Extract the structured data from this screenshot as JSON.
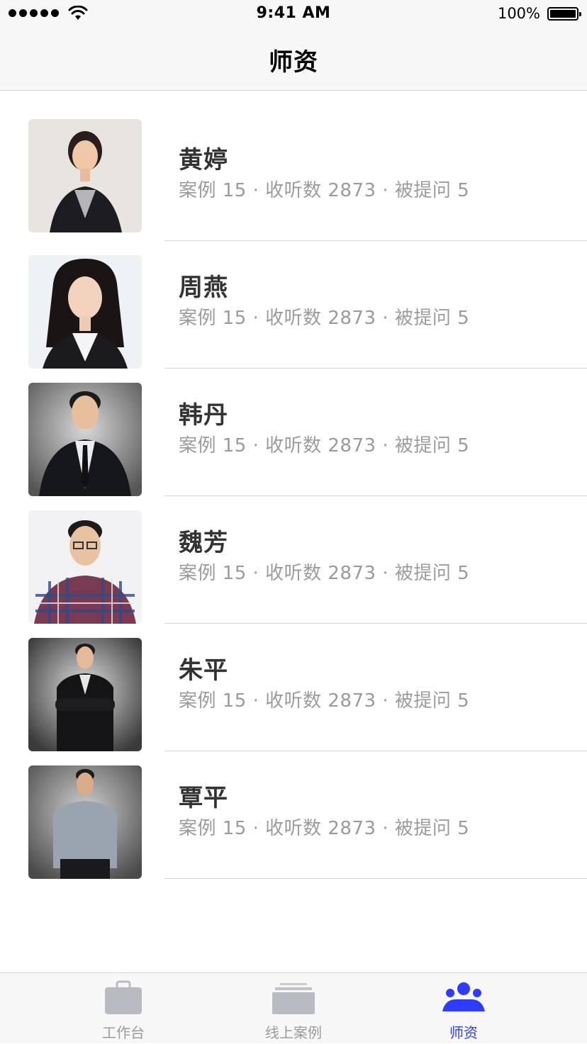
{
  "status_bar": {
    "time": "9:41 AM",
    "battery_percent": "100%",
    "icons": [
      "signal-icon",
      "wifi-icon",
      "battery-icon"
    ]
  },
  "nav": {
    "title": "师资"
  },
  "teachers": [
    {
      "name": "黄婷",
      "stats": "案例 15 · 收听数 2873 · 被提问 5"
    },
    {
      "name": "周燕",
      "stats": "案例 15 · 收听数 2873 · 被提问 5"
    },
    {
      "name": "韩丹",
      "stats": "案例 15 · 收听数 2873 · 被提问 5"
    },
    {
      "name": "魏芳",
      "stats": "案例 15 · 收听数 2873 · 被提问 5"
    },
    {
      "name": "朱平",
      "stats": "案例 15 · 收听数 2873 · 被提问 5"
    },
    {
      "name": "覃平",
      "stats": "案例 15 · 收听数 2873 · 被提问 5"
    }
  ],
  "tab_bar": {
    "tabs": [
      {
        "label": "工作台",
        "icon": "briefcase-icon",
        "active": false
      },
      {
        "label": "线上案例",
        "icon": "stack-icon",
        "active": false
      },
      {
        "label": "师资",
        "icon": "people-icon",
        "active": true
      }
    ]
  },
  "colors": {
    "accent": "#2f3bff",
    "inactive": "#9b9b9b",
    "bar_background": "#f7f7f7"
  }
}
